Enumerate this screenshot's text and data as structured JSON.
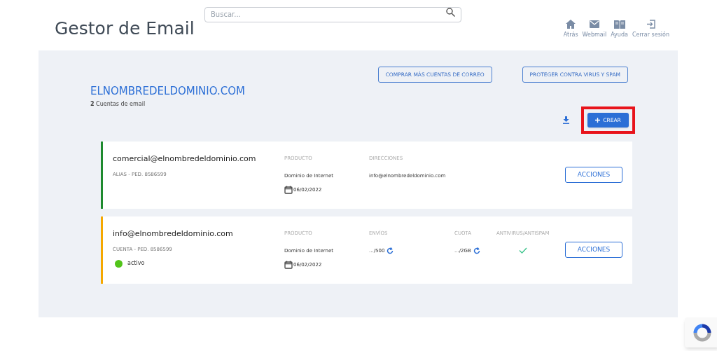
{
  "header": {
    "title": "Gestor de Email",
    "search": {
      "placeholder": "Buscar..."
    },
    "nav": [
      {
        "label": "Atrás"
      },
      {
        "label": "Webmail"
      },
      {
        "label": "Ayuda"
      },
      {
        "label": "Cerrar sesión"
      }
    ]
  },
  "domain": {
    "name": "ELNOMBREDELDOMINIO.COM",
    "count": "2",
    "count_label": "Cuentas de email",
    "buttons": [
      "COMPRAR MÁS CUENTAS DE CORREO",
      "PROTEGER CONTRA VIRUS Y SPAM"
    ],
    "create_button": {
      "label": "CREAR",
      "highlighted": true
    }
  },
  "accounts": [
    {
      "kind": "alias",
      "color": "#1e8a2e",
      "email": "comercial@elnombredeldominio.com",
      "subtitle": "ALIAS - PED. 8586599",
      "product_label": "PRODUCTO",
      "product": "Dominio de Internet",
      "date": "06/02/2022",
      "addresses_label": "DIRECCIONES",
      "addresses": "info@elnombredeldominio.com",
      "action": "ACCIONES"
    },
    {
      "kind": "cuenta",
      "color": "#f5a800",
      "email": "info@elnombredeldominio.com",
      "subtitle": "CUENTA - PED. 8586599",
      "status": {
        "label": "activo",
        "color": "#52c41a"
      },
      "product_label": "PRODUCTO",
      "product": "Dominio de Internet",
      "date": "06/02/2022",
      "sends_label": "ENVÍOS",
      "sends": ".../500",
      "quota_label": "CUOTA",
      "quota": ".../2GB",
      "antivirus_label": "ANTIVIRUS/ANTISPAM",
      "antivirus": true,
      "action": "ACCIONES"
    }
  ]
}
